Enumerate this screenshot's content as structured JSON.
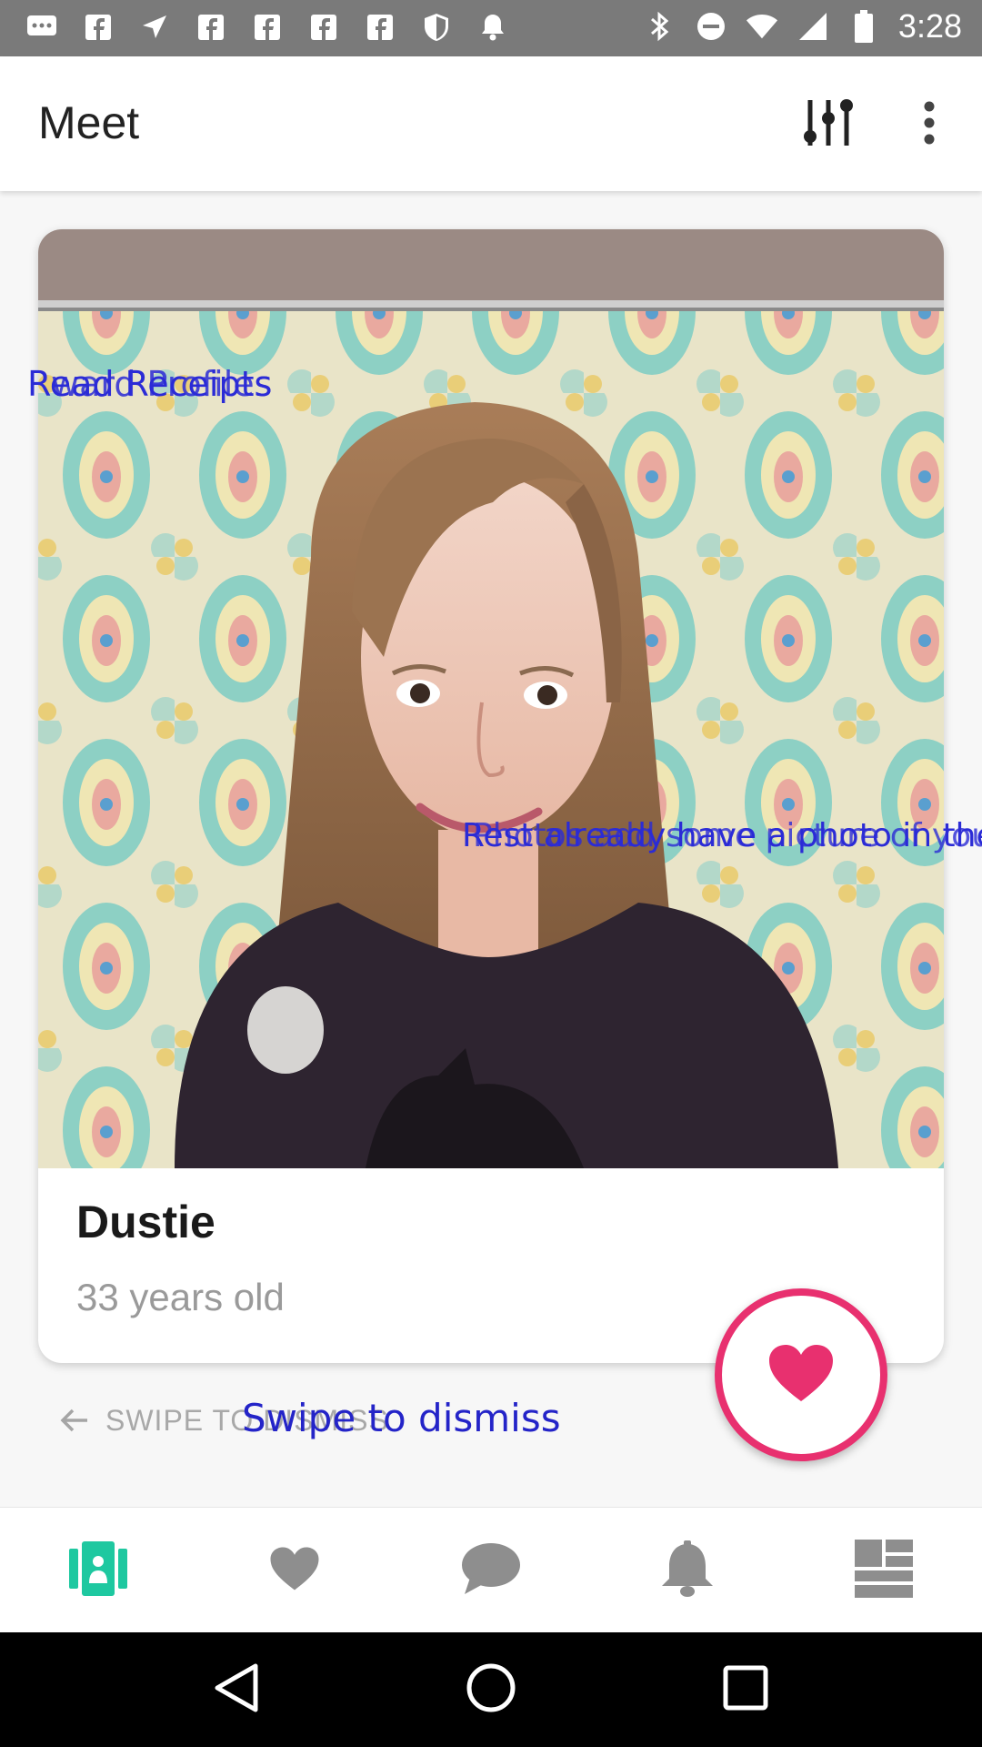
{
  "status_bar": {
    "time": "3:28",
    "left_icons": [
      "message-icon",
      "facebook-icon",
      "navigation-icon",
      "facebook-icon",
      "facebook-icon",
      "facebook-icon",
      "facebook-icon",
      "shield-icon",
      "bell-icon"
    ],
    "right_icons": [
      "bluetooth-icon",
      "dnd-icon",
      "wifi-icon",
      "signal-icon",
      "battery-icon"
    ]
  },
  "app_bar": {
    "title": "Meet",
    "filter_icon": "sliders-icon",
    "more_icon": "more-vert-icon"
  },
  "card": {
    "name": "Dustie",
    "age_text": "33 years old"
  },
  "overlays": {
    "read_label_a": "Read Receipts",
    "read_label_b": "ward Profiles",
    "mid_label_a": "Rest already have a photo in the",
    "mid_label_b": "Photos add some picture of you"
  },
  "swipe": {
    "hint_text": "SWIPE TO DISMISS",
    "overlay_text": "Swipe to dismiss"
  },
  "bottom_nav": {
    "items": [
      {
        "icon": "cards-icon",
        "active": true
      },
      {
        "icon": "heart-icon",
        "active": false
      },
      {
        "icon": "chat-icon",
        "active": false
      },
      {
        "icon": "notification-bell-icon",
        "active": false
      },
      {
        "icon": "dashboard-icon",
        "active": false
      }
    ]
  },
  "colors": {
    "accent": "#1ec8a0",
    "like": "#e8306f",
    "nav_inactive": "#8e8e8e"
  }
}
